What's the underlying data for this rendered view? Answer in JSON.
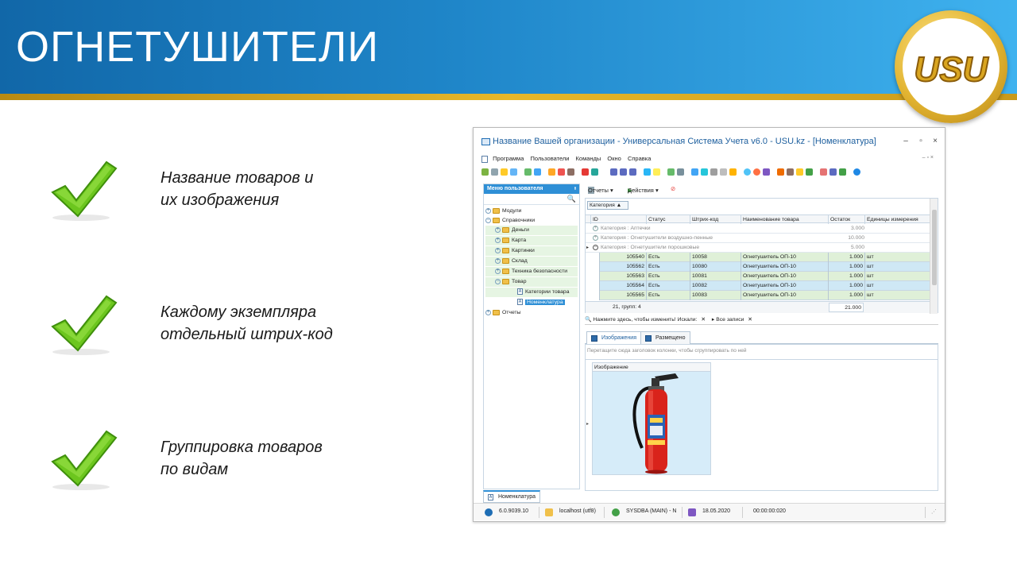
{
  "slide": {
    "title": "ОГНЕТУШИТЕЛИ",
    "logo_text": "USU",
    "features": [
      {
        "line1": "Название товаров и",
        "line2": "их изображения"
      },
      {
        "line1": "Каждому экземпляра",
        "line2": "отдельный штрих-код"
      },
      {
        "line1": "Группировка товаров",
        "line2": "по видам"
      }
    ]
  },
  "window": {
    "title": "Название Вашей организации - Универсальная Система Учета v6.0 - USU.kz - [Номенклатура]",
    "controls": {
      "minimize": "–",
      "maximize": "▫",
      "close": "×"
    },
    "mdi_controls": "– ▫ ×",
    "menu": [
      "Программа",
      "Пользователи",
      "Команды",
      "Окно",
      "Справка"
    ]
  },
  "left_panel": {
    "header": "Меню пользователя",
    "pin": "ᵻ",
    "search_icon": "🔍",
    "tree": [
      {
        "label": "Модули",
        "level": 0,
        "type": "folder",
        "expander": "+"
      },
      {
        "label": "Справочники",
        "level": 0,
        "type": "folder",
        "expander": "−"
      },
      {
        "label": "Деньги",
        "level": 1,
        "type": "folder",
        "expander": "+"
      },
      {
        "label": "Карта",
        "level": 1,
        "type": "folder",
        "expander": "+"
      },
      {
        "label": "Картинки",
        "level": 1,
        "type": "folder",
        "expander": "+"
      },
      {
        "label": "Склад",
        "level": 1,
        "type": "folder",
        "expander": "+"
      },
      {
        "label": "Техника безопасности",
        "level": 1,
        "type": "folder",
        "expander": "+"
      },
      {
        "label": "Товар",
        "level": 1,
        "type": "folder",
        "expander": "−"
      },
      {
        "label": "Категории товара",
        "level": 2,
        "type": "doc",
        "expander": ""
      },
      {
        "label": "Номенклатура",
        "level": 2,
        "type": "doc",
        "expander": "",
        "selected": true
      },
      {
        "label": "Отчеты",
        "level": 0,
        "type": "folder",
        "expander": "+"
      }
    ]
  },
  "grid": {
    "toolbar": {
      "reports": "Отчеты ▾",
      "actions": "Действия ▾"
    },
    "group_by": "Категория ▲",
    "columns": [
      "ID",
      "Статус",
      "Штрих-код",
      "Наименование товара",
      "Остаток",
      "Единицы измерения"
    ],
    "groups": [
      {
        "label": "Категория : Аптечки",
        "value": "3.000",
        "expander": "+"
      },
      {
        "label": "Категория : Огнетушители воздушно-пенные",
        "value": "10.000",
        "expander": "+"
      },
      {
        "label": "Категория : Огнетушители порошковые",
        "value": "5.000",
        "expander": "−"
      }
    ],
    "rows": [
      {
        "id": "105540",
        "status": "Есть",
        "barcode": "10058",
        "name": "Огнетушитель ОП-10",
        "stock": "1.000",
        "unit": "шт"
      },
      {
        "id": "105562",
        "status": "Есть",
        "barcode": "10080",
        "name": "Огнетушитель ОП-10",
        "stock": "1.000",
        "unit": "шт"
      },
      {
        "id": "105563",
        "status": "Есть",
        "barcode": "10081",
        "name": "Огнетушитель ОП-10",
        "stock": "1.000",
        "unit": "шт"
      },
      {
        "id": "105564",
        "status": "Есть",
        "barcode": "10082",
        "name": "Огнетушитель ОП-10",
        "stock": "1.000",
        "unit": "шт"
      },
      {
        "id": "105565",
        "status": "Есть",
        "barcode": "10083",
        "name": "Огнетушитель ОП-10",
        "stock": "1.000",
        "unit": "шт"
      }
    ],
    "footer": {
      "count": "21, групп: 4",
      "total": "21.000"
    },
    "filter": {
      "prompt": "Нажмите здесь, чтобы изменить! Искали:",
      "all": "Все записи"
    }
  },
  "detail": {
    "tabs": [
      "Изображения",
      "Размещено"
    ],
    "hint": "Перетащите сюда заголовок колонки, чтобы сгруппировать по ней",
    "column": "Изображение"
  },
  "bottom_tab": "Номенклатура",
  "status": {
    "version": "6.0.9039.10",
    "server": "localhost (utf8)",
    "user": "SYSDBA (MAIN) - N",
    "date": "18.05.2020",
    "time": "00:00:00:020"
  },
  "colors": {
    "header_blue": "#1f86c9",
    "gold": "#e2b431",
    "check_green": "#6cc61e",
    "row_green": "#dff0d8",
    "row_blue": "#cfe8f5",
    "accent": "#2e8fd6"
  }
}
